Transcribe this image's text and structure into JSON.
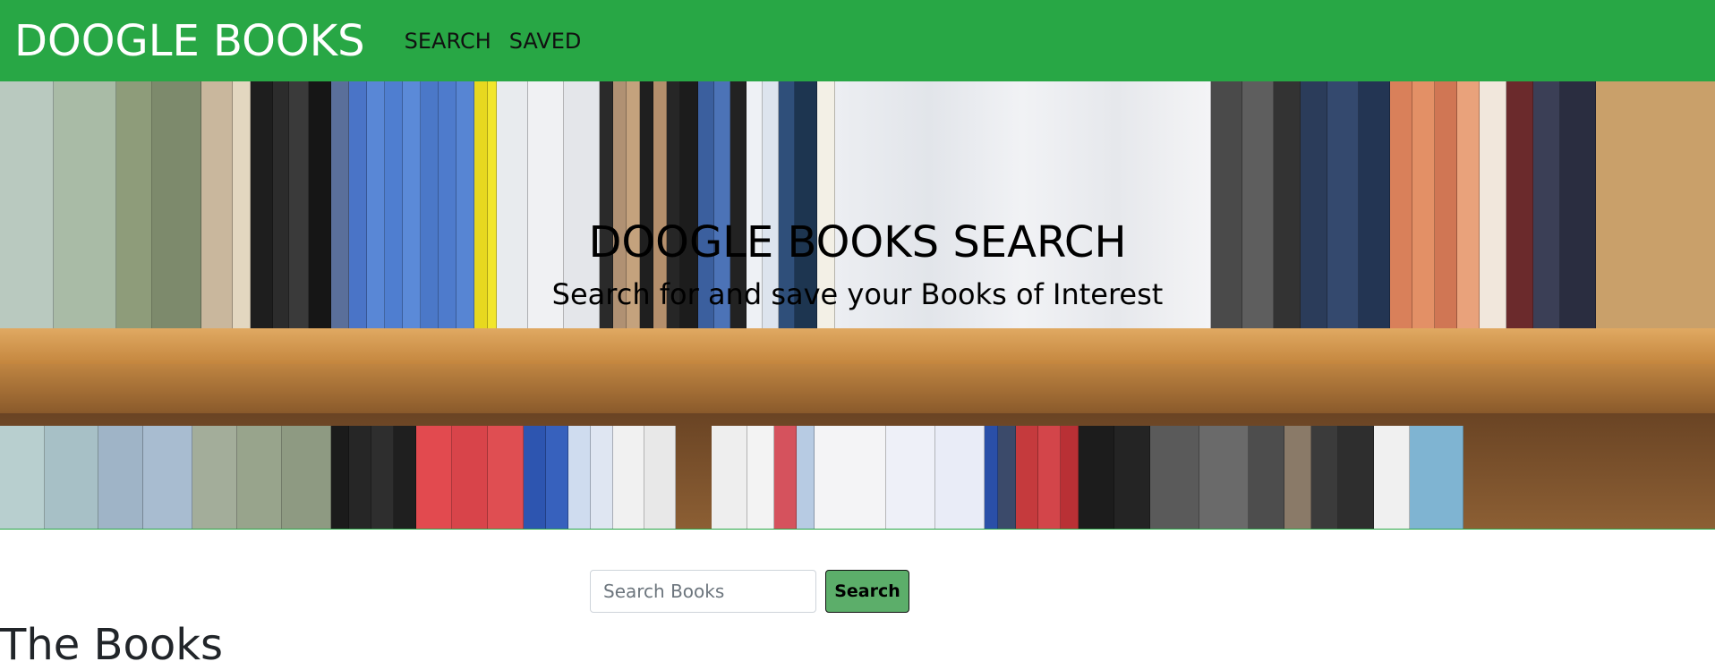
{
  "navbar": {
    "brand": "DOOGLE BOOKS",
    "links": [
      "SEARCH",
      "SAVED"
    ],
    "background": "#28a745"
  },
  "hero": {
    "title": "DOOGLE BOOKS SEARCH",
    "subtitle": "Search for and save your Books of Interest",
    "image": "bookshelf-photo"
  },
  "search": {
    "placeholder": "Search Books",
    "value": "",
    "button_label": "Search",
    "button_color": "#5cae6a"
  },
  "results": {
    "heading": "The Books"
  }
}
